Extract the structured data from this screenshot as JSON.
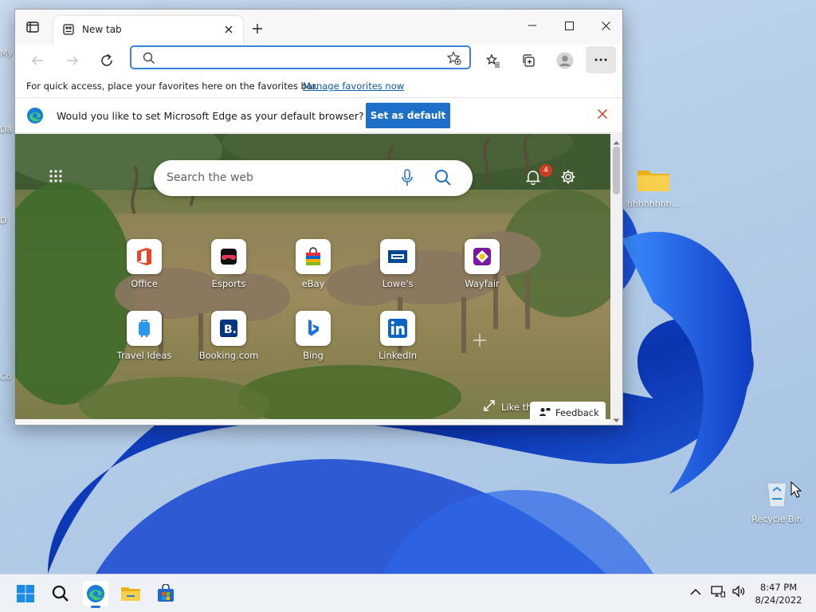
{
  "desktop": {
    "folder_label": "hhhhhhhh...",
    "recycle_bin_label": "Recycle Bin",
    "edge_labels": [
      "My",
      "Da",
      "D",
      "Co"
    ]
  },
  "browser": {
    "tab_title": "New tab",
    "address_value": "",
    "favorites_bar": {
      "message": "For quick access, place your favorites here on the favorites bar.",
      "link": "Manage favorites now"
    },
    "infobar": {
      "message": "Would you like to set Microsoft Edge as your default browser?",
      "button": "Set as default"
    },
    "new_tab_page": {
      "search_placeholder": "Search the web",
      "notification_count": "4",
      "quick_links_row1": [
        "Office",
        "Esports",
        "eBay",
        "Lowe's",
        "Wayfair"
      ],
      "quick_links_row2": [
        "Travel Ideas",
        "Booking.com",
        "Bing",
        "LinkedIn"
      ],
      "like_text": "Like th",
      "feedback": "Feedback"
    }
  },
  "taskbar": {
    "time": "8:47 PM",
    "date": "8/24/2022"
  },
  "colors": {
    "accent": "#1e6fc8",
    "address_border": "#3b82d9",
    "link": "#0f5aa8",
    "close_red": "#d13b1f"
  }
}
